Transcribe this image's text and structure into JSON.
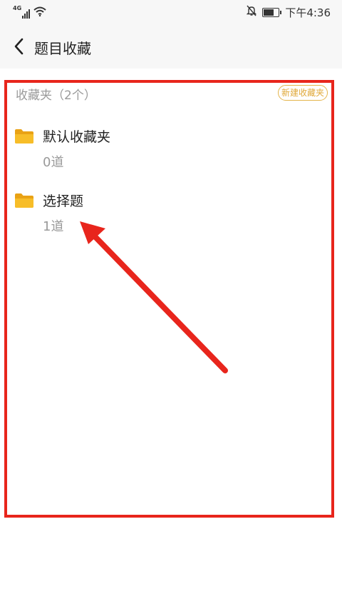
{
  "status_bar": {
    "network": "4G",
    "time": "下午4:36",
    "battery_level": 0.8,
    "icons": [
      "signal-icon",
      "wifi-icon",
      "mute-bell-icon",
      "battery-icon"
    ]
  },
  "header": {
    "title": "题目收藏",
    "back_icon": "chevron-left-icon"
  },
  "favorites": {
    "section_title": "收藏夹（2个）",
    "new_folder_label": "新建收藏夹",
    "folders": [
      {
        "name": "默认收藏夹",
        "count": "0道",
        "icon": "folder-icon"
      },
      {
        "name": "选择题",
        "count": "1道",
        "icon": "folder-icon"
      }
    ]
  },
  "annotations": {
    "highlight_color": "#e8251c",
    "arrow_color": "#e8251c"
  },
  "colors": {
    "accent": "#e4b44a",
    "folder": "#f5b820",
    "muted_text": "#9a9a9a"
  }
}
